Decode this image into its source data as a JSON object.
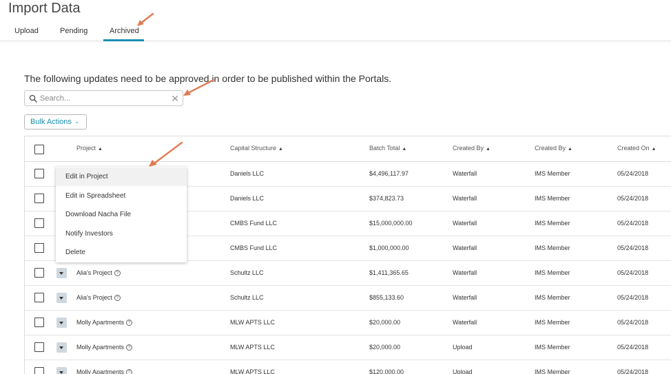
{
  "page": {
    "title": "Import Data"
  },
  "tabs": [
    {
      "label": "Upload"
    },
    {
      "label": "Pending"
    },
    {
      "label": "Archived"
    }
  ],
  "intro_text": "The following updates need to be approved in order to be published within the Portals.",
  "search": {
    "placeholder": "Search...",
    "value": ""
  },
  "bulk_actions": {
    "label": "Bulk Actions"
  },
  "table": {
    "columns": [
      "Project",
      "Capital Structure",
      "Batch Total",
      "Created By",
      "Created By",
      "Created On"
    ],
    "rows": [
      {
        "project": "",
        "capital_structure": "Daniels LLC",
        "batch_total": "$4,496,117.97",
        "created_by": "Waterfall",
        "created_by_user": "IMS Member",
        "created_on": "05/24/2018"
      },
      {
        "project": "",
        "capital_structure": "Daniels LLC",
        "batch_total": "$374,823.73",
        "created_by": "Waterfall",
        "created_by_user": "IMS Member",
        "created_on": "05/24/2018"
      },
      {
        "project": "",
        "capital_structure": "CMBS Fund LLC",
        "batch_total": "$15,000,000.00",
        "created_by": "Waterfall",
        "created_by_user": "IMS Member",
        "created_on": "05/24/2018"
      },
      {
        "project": "",
        "capital_structure": "CMBS Fund LLC",
        "batch_total": "$1,000,000.00",
        "created_by": "Waterfall",
        "created_by_user": "IMS Member",
        "created_on": "05/24/2018"
      },
      {
        "project": "Alia's Project",
        "capital_structure": "Schultz LLC",
        "batch_total": "$1,411,365.65",
        "created_by": "Waterfall",
        "created_by_user": "IMS Member",
        "created_on": "05/24/2018"
      },
      {
        "project": "Alia's Project",
        "capital_structure": "Schultz LLC",
        "batch_total": "$855,133.60",
        "created_by": "Waterfall",
        "created_by_user": "IMS Member",
        "created_on": "05/24/2018"
      },
      {
        "project": "Molly Apartments",
        "capital_structure": "MLW APTS LLC",
        "batch_total": "$20,000.00",
        "created_by": "Waterfall",
        "created_by_user": "IMS Member",
        "created_on": "05/24/2018"
      },
      {
        "project": "Molly Apartments",
        "capital_structure": "MLW APTS LLC",
        "batch_total": "$20,000.00",
        "created_by": "Upload",
        "created_by_user": "IMS Member",
        "created_on": "05/24/2018"
      },
      {
        "project": "Molly Apartments",
        "capital_structure": "MLW APTS LLC",
        "batch_total": "$120,000.00",
        "created_by": "Upload",
        "created_by_user": "IMS Member",
        "created_on": "05/24/2018"
      }
    ]
  },
  "row_menu": {
    "items": [
      "Edit in Project",
      "Edit in Spreadsheet",
      "Download Nacha File",
      "Notify Investors",
      "Delete"
    ]
  },
  "colors": {
    "accent": "#1a8fb0",
    "annotation_arrow": "#e07b53"
  }
}
